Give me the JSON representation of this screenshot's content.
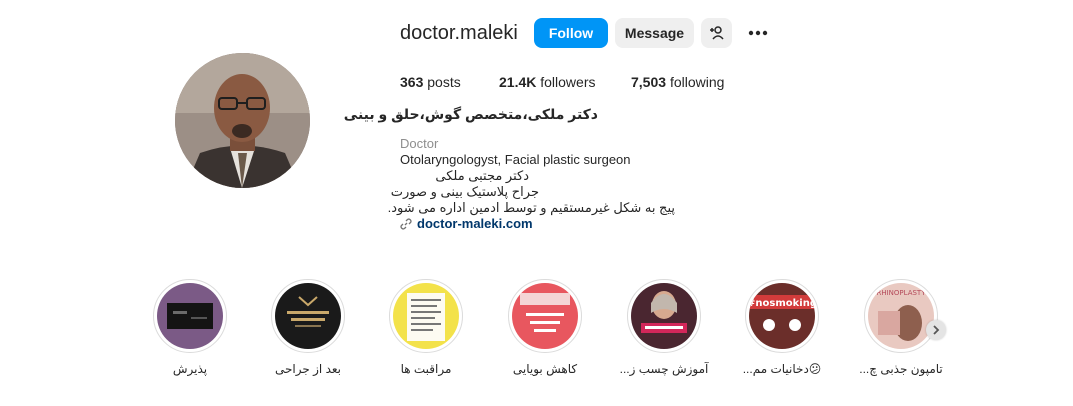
{
  "profile": {
    "username": "doctor.maleki",
    "follow_label": "Follow",
    "message_label": "Message",
    "add_user_icon": "person-plus-icon",
    "more_icon": "more-dots-icon"
  },
  "stats": {
    "posts_count": "363",
    "posts_label": "posts",
    "followers_count": "21.4K",
    "followers_label": "followers",
    "following_count": "7,503",
    "following_label": "following"
  },
  "bio": {
    "full_name": "دکتر ملکی،متخصص گوش،حلق و بینی",
    "category": "Doctor",
    "line1": "Otolaryngologyst, Facial plastic surgeon",
    "line2": "دکتر مجتبی ملکی",
    "line3": "جراح پلاستیک بینی و صورت",
    "line4": "پیج به شکل غیرمستقیم و توسط ادمین اداره می شود.",
    "link_text": "doctor-maleki.com",
    "link_icon": "link-icon"
  },
  "highlights": [
    {
      "label": "پذیرش",
      "icon": "highlight-cover-1"
    },
    {
      "label": "بعد از جراحی",
      "icon": "highlight-cover-2"
    },
    {
      "label": "مراقبت ها",
      "icon": "highlight-cover-3"
    },
    {
      "label": "کاهش بویایی",
      "icon": "highlight-cover-4"
    },
    {
      "label": "آموزش چسب ز...",
      "icon": "highlight-cover-5"
    },
    {
      "label": "😕دخانیات مم...",
      "icon": "highlight-cover-6",
      "cover_text": "#nosmoking"
    },
    {
      "label": "تامپون جذبی چ...",
      "icon": "highlight-cover-7",
      "cover_text": "RHINOPLASTY"
    }
  ],
  "colors": {
    "accent": "#0095f6",
    "link": "#00376b",
    "secondary_button": "#efefef"
  }
}
